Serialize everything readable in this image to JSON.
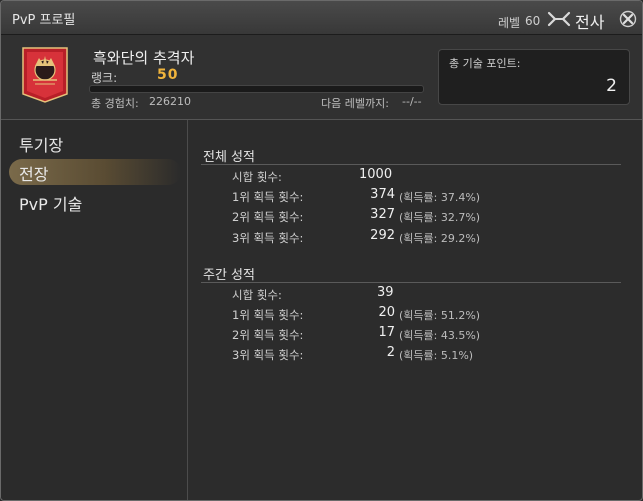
{
  "window": {
    "title": "PvP 프로필",
    "level_label": "레벨",
    "level_value": "60",
    "job_name": "전사"
  },
  "profile": {
    "name": "흑와단의 추격자",
    "rank_label": "랭크:",
    "rank_value": "50",
    "xp_label": "총 경험치:",
    "xp_value": "226210",
    "next_label": "다음 레벨까지:",
    "next_value": "--/--",
    "xp_progress": 0,
    "points_label": "총 기술 포인트:",
    "points_value": "2"
  },
  "sidebar": {
    "items": [
      {
        "label": "투기장",
        "active": false
      },
      {
        "label": "전장",
        "active": true
      },
      {
        "label": "PvP 기술",
        "active": false
      }
    ]
  },
  "overall": {
    "title": "전체 성적",
    "matches_label": "시합 횟수:",
    "matches_value": "1000",
    "rows": [
      {
        "label": "1위 획득 횟수:",
        "value": "374",
        "pct": "(획득률: 37.4%)"
      },
      {
        "label": "2위 획득 횟수:",
        "value": "327",
        "pct": "(획득률: 32.7%)"
      },
      {
        "label": "3위 획득 횟수:",
        "value": "292",
        "pct": "(획득률: 29.2%)"
      }
    ]
  },
  "weekly": {
    "title": "주간 성적",
    "matches_label": "시합 횟수:",
    "matches_value": "39",
    "rows": [
      {
        "label": "1위 획득 횟수:",
        "value": "20",
        "pct": "(획득률: 51.2%)"
      },
      {
        "label": "2위 획득 횟수:",
        "value": "17",
        "pct": "(획득률: 43.5%)"
      },
      {
        "label": "3위 획득 횟수:",
        "value": "2",
        "pct": "(획득률: 5.1%)"
      }
    ]
  },
  "icons": {
    "job": "warrior-job-icon",
    "close": "close-icon",
    "emblem": "pvp-rank-emblem"
  },
  "colors": {
    "accent": "#f0b43c",
    "emblem_red": "#c0242c"
  }
}
